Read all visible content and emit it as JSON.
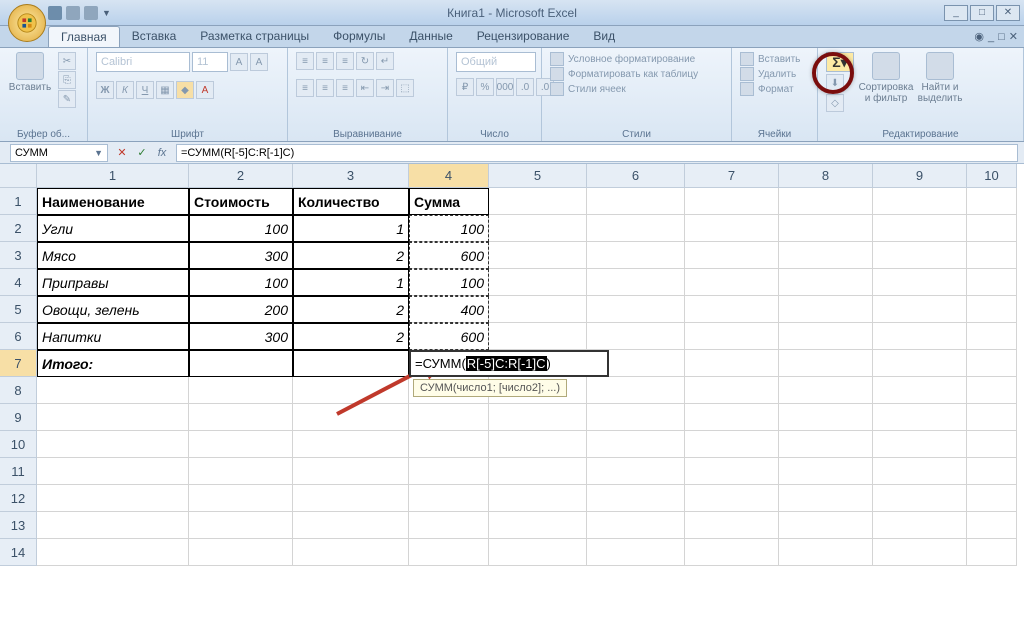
{
  "app": {
    "title": "Книга1 - Microsoft Excel"
  },
  "tabs": {
    "items": [
      "Главная",
      "Вставка",
      "Разметка страницы",
      "Формулы",
      "Данные",
      "Рецензирование",
      "Вид"
    ],
    "active": 0
  },
  "ribbon": {
    "paste": "Вставить",
    "clipboard_group": "Буфер об...",
    "font_group": "Шрифт",
    "font_name": "Calibri",
    "font_size": "11",
    "alignment_group": "Выравнивание",
    "number_group": "Число",
    "number_format": "Общий",
    "styles_group": "Стили",
    "cond_format": "Условное форматирование",
    "format_table": "Форматировать как таблицу",
    "cell_styles": "Стили ячеек",
    "cells_group": "Ячейки",
    "insert": "Вставить",
    "delete": "Удалить",
    "format": "Формат",
    "editing_group": "Редактирование",
    "sort_filter": "Сортировка и фильтр",
    "find_select": "Найти и выделить",
    "sigma": "Σ"
  },
  "formula_bar": {
    "name_box": "СУММ",
    "formula": "=СУММ(R[-5]C:R[-1]C)"
  },
  "columns": [
    {
      "n": "1",
      "w": 152
    },
    {
      "n": "2",
      "w": 104
    },
    {
      "n": "3",
      "w": 116
    },
    {
      "n": "4",
      "w": 80
    },
    {
      "n": "5",
      "w": 98
    },
    {
      "n": "6",
      "w": 98
    },
    {
      "n": "7",
      "w": 94
    },
    {
      "n": "8",
      "w": 94
    },
    {
      "n": "9",
      "w": 94
    },
    {
      "n": "10",
      "w": 50
    }
  ],
  "headers": [
    "Наименование",
    "Стоимость",
    "Количество",
    "Сумма"
  ],
  "rows": [
    {
      "name": "Угли",
      "cost": "100",
      "qty": "1",
      "sum": "100"
    },
    {
      "name": "Мясо",
      "cost": "300",
      "qty": "2",
      "sum": "600"
    },
    {
      "name": "Приправы",
      "cost": "100",
      "qty": "1",
      "sum": "100"
    },
    {
      "name": "Овощи, зелень",
      "cost": "200",
      "qty": "2",
      "sum": "400"
    },
    {
      "name": "Напитки",
      "cost": "300",
      "qty": "2",
      "sum": "600"
    }
  ],
  "total_label": "Итого:",
  "active_formula": {
    "prefix": "=СУММ(",
    "sel": "R[-5]C:R[-1]C",
    "suffix": ")"
  },
  "tooltip": "СУММ(число1; [число2]; ...)",
  "row_count": 14
}
